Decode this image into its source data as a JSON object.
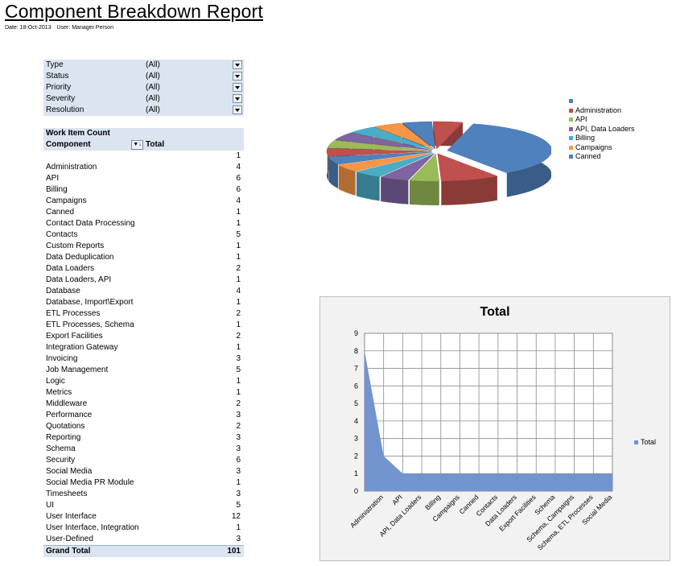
{
  "report": {
    "title": "Component Breakdown Report",
    "date": "Date: 18-Oct-2013",
    "user": "User: Manager Person"
  },
  "filters": [
    {
      "label": "Type",
      "value": "(All)"
    },
    {
      "label": "Status",
      "value": "(All)"
    },
    {
      "label": "Priority",
      "value": "(All)"
    },
    {
      "label": "Severity",
      "value": "(All)"
    },
    {
      "label": "Resolution",
      "value": "(All)"
    }
  ],
  "pivot": {
    "header": "Work Item Count",
    "col_component": "Component",
    "col_total": "Total",
    "sort_icon": "sort-az-icon",
    "rows": [
      {
        "name": "",
        "value": "1"
      },
      {
        "name": "Administration",
        "value": "4"
      },
      {
        "name": "API",
        "value": "6"
      },
      {
        "name": "Billing",
        "value": "6"
      },
      {
        "name": "Campaigns",
        "value": "4"
      },
      {
        "name": "Canned",
        "value": "1"
      },
      {
        "name": "Contact Data Processing",
        "value": "1"
      },
      {
        "name": "Contacts",
        "value": "5"
      },
      {
        "name": "Custom Reports",
        "value": "1"
      },
      {
        "name": "Data Deduplication",
        "value": "1"
      },
      {
        "name": "Data Loaders",
        "value": "2"
      },
      {
        "name": "Data Loaders, API",
        "value": "1"
      },
      {
        "name": "Database",
        "value": "4"
      },
      {
        "name": "Database, Import\\Export",
        "value": "1"
      },
      {
        "name": "ETL Processes",
        "value": "2"
      },
      {
        "name": "ETL Processes, Schema",
        "value": "1"
      },
      {
        "name": "Export Facilities",
        "value": "2"
      },
      {
        "name": "Integration Gateway",
        "value": "1"
      },
      {
        "name": "Invoicing",
        "value": "3"
      },
      {
        "name": "Job Management",
        "value": "5"
      },
      {
        "name": "Logic",
        "value": "1"
      },
      {
        "name": "Metrics",
        "value": "1"
      },
      {
        "name": "Middleware",
        "value": "2"
      },
      {
        "name": "Performance",
        "value": "3"
      },
      {
        "name": "Quotations",
        "value": "2"
      },
      {
        "name": "Reporting",
        "value": "3"
      },
      {
        "name": "Schema",
        "value": "3"
      },
      {
        "name": "Security",
        "value": "6"
      },
      {
        "name": "Social Media",
        "value": "3"
      },
      {
        "name": "Social Media PR Module",
        "value": "1"
      },
      {
        "name": "Timesheets",
        "value": "3"
      },
      {
        "name": "UI",
        "value": "5"
      },
      {
        "name": "User Interface",
        "value": "12"
      },
      {
        "name": "User Interface, Integration",
        "value": "1"
      },
      {
        "name": "User-Defined",
        "value": "3"
      }
    ],
    "grand_total_label": "Grand Total",
    "grand_total": "101"
  },
  "pie_legend": [
    {
      "label": "",
      "color": "#4f81bd"
    },
    {
      "label": "Administration",
      "color": "#c0504d"
    },
    {
      "label": "API",
      "color": "#9bbb59"
    },
    {
      "label": "API, Data Loaders",
      "color": "#8064a2"
    },
    {
      "label": "Billing",
      "color": "#4bacc6"
    },
    {
      "label": "Campaigns",
      "color": "#f79646"
    },
    {
      "label": "Canned",
      "color": "#4f81bd"
    }
  ],
  "chart_data": [
    {
      "type": "pie",
      "title": "",
      "slices": [
        {
          "label": "",
          "value": 8,
          "color": "#4f81bd"
        },
        {
          "label": "Administration",
          "value": 2,
          "color": "#c0504d"
        },
        {
          "label": "API",
          "value": 1,
          "color": "#9bbb59"
        },
        {
          "label": "API, Data Loaders",
          "value": 1,
          "color": "#8064a2"
        },
        {
          "label": "Billing",
          "value": 1,
          "color": "#4bacc6"
        },
        {
          "label": "Campaigns",
          "value": 1,
          "color": "#f79646"
        },
        {
          "label": "Canned",
          "value": 1,
          "color": "#4f81bd"
        },
        {
          "label": "",
          "value": 1,
          "color": "#c0504d"
        },
        {
          "label": "",
          "value": 1,
          "color": "#9bbb59"
        },
        {
          "label": "",
          "value": 1,
          "color": "#8064a2"
        },
        {
          "label": "",
          "value": 1,
          "color": "#4bacc6"
        },
        {
          "label": "",
          "value": 1,
          "color": "#f79646"
        },
        {
          "label": "",
          "value": 1,
          "color": "#4f81bd"
        },
        {
          "label": "",
          "value": 1,
          "color": "#c0504d"
        }
      ]
    },
    {
      "type": "area",
      "title": "Total",
      "categories": [
        "",
        "Administration",
        "API",
        "API, Data Loaders",
        "Billing",
        "Campaigns",
        "Canned",
        "Contacts",
        "Data Loaders",
        "Export Facilities",
        "Schema",
        "Schema, Campaigns",
        "Schema, ETL Processes",
        "Social Media"
      ],
      "series": [
        {
          "name": "Total",
          "values": [
            8,
            2,
            1,
            1,
            1,
            1,
            1,
            1,
            1,
            1,
            1,
            1,
            1,
            1
          ]
        }
      ],
      "yticks": [
        "0",
        "1",
        "2",
        "3",
        "4",
        "5",
        "6",
        "7",
        "8",
        "9"
      ],
      "ylim": [
        0,
        9
      ],
      "grid": true,
      "legend": "right",
      "color": "#7294cf"
    }
  ]
}
